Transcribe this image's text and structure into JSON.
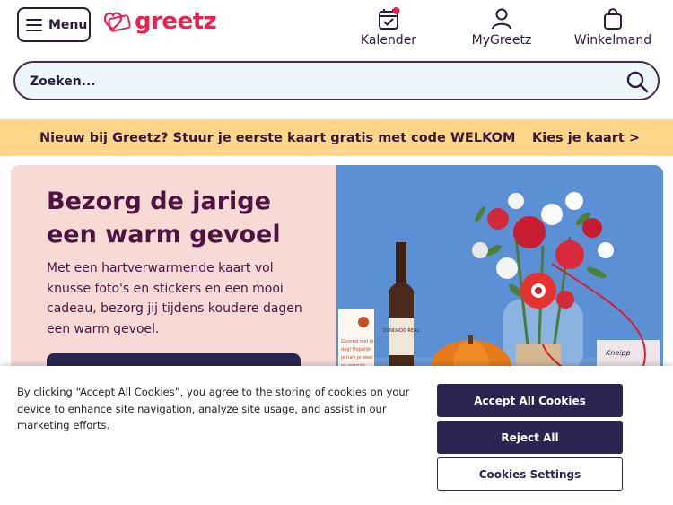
{
  "header": {
    "menu_label": "Menu",
    "logo_text": "greetz",
    "nav": [
      {
        "label": "Kalender",
        "icon": "calendar-icon"
      },
      {
        "label": "MyGreetz",
        "icon": "user-icon"
      },
      {
        "label": "Winkelmand",
        "icon": "shopping-bag-icon"
      }
    ],
    "notification_color": "#e8234f"
  },
  "search": {
    "placeholder": "Zoeken...",
    "icon": "search-icon"
  },
  "promo": {
    "text": "Nieuw bij Greetz? Stuur je eerste kaart gratis met code WELKOM",
    "link": "Kies je kaart >"
  },
  "hero": {
    "title": "Bezorg de jarige een warm gevoel",
    "text": "Met een hartverwarmende kaart vol knusse foto's en stickers en een mooi cadeau, bezorg jij tijdens koudere dagen een warm gevoel.",
    "image_alt": "flowers-wine-gift-image",
    "wine_label": "CONDADO REAL",
    "card_lines": [
      "Gezond met je",
      "dag! Hopelijk",
      "je hart je weel",
      "en warmte."
    ],
    "box_label": "Kneipp"
  },
  "cookie_banner": {
    "text": "By clicking “Accept All Cookies”, you agree to the storing of cookies on your device to enhance site navigation, analyze site usage, and assist in our marketing efforts.",
    "accept": "Accept All Cookies",
    "reject": "Reject All",
    "settings": "Cookies Settings"
  },
  "colors": {
    "brand": "#e8234f",
    "primary": "#2a2451",
    "promo_bg": "#fdd68a",
    "hero_bg": "#f7d9d6",
    "search_bg": "#eef6fc"
  }
}
